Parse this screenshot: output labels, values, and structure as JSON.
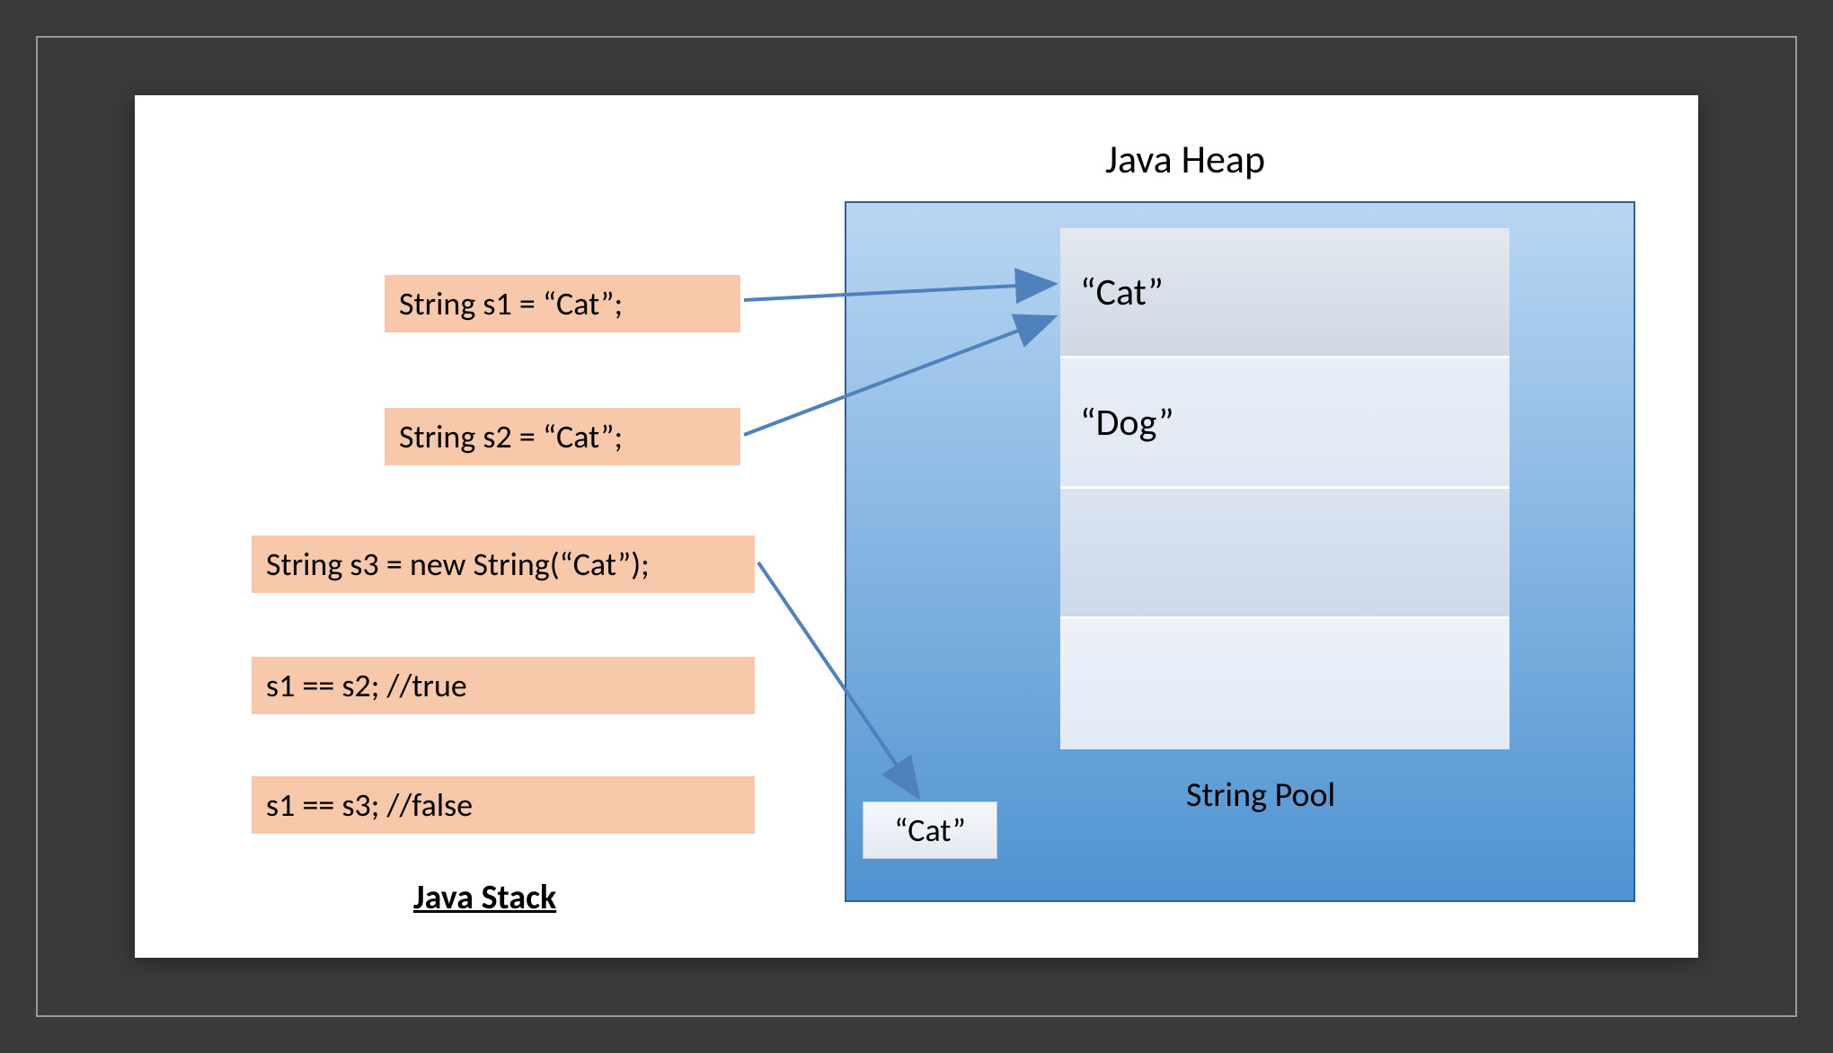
{
  "heap": {
    "title": "Java Heap",
    "pool_label": "String Pool",
    "pool_rows": {
      "r1": "“Cat”",
      "r2": "“Dog”",
      "r3": "",
      "r4": ""
    },
    "heap_object": "“Cat”"
  },
  "stack": {
    "label": "Java Stack",
    "lines": {
      "l1": "String s1 = “Cat”;",
      "l2": "String s2 = “Cat”;",
      "l3": "String s3 = new String(“Cat”);",
      "l4": "s1 == s2; //true",
      "l5": "s1 == s3; //false"
    }
  },
  "colors": {
    "code_box_bg": "#f7c8aa",
    "heap_border": "#2f5f93",
    "arrow": "#4f81bd"
  }
}
